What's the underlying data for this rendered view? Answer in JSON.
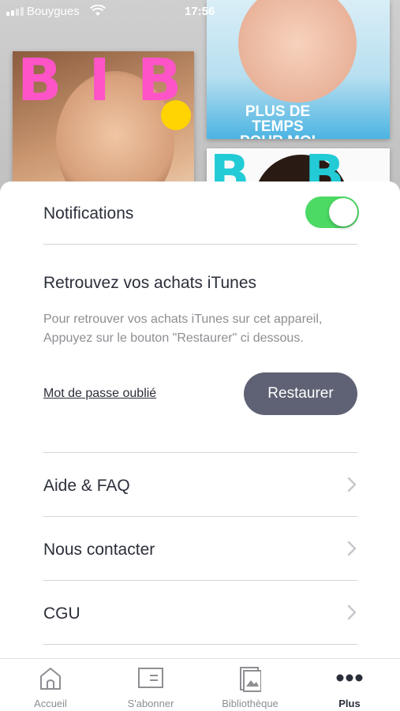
{
  "status_bar": {
    "carrier": "Bouygues",
    "time": "17:56"
  },
  "settings": {
    "notifications_label": "Notifications",
    "notifications_on": true,
    "itunes_title": "Retrouvez vos achats iTunes",
    "itunes_description": "Pour retrouver vos achats iTunes sur cet appareil, Appuyez sur le bouton \"Restaurer\" ci dessous.",
    "forgot_password": "Mot de passe oublié",
    "restore_button": "Restaurer"
  },
  "menu": [
    {
      "label": "Aide & FAQ"
    },
    {
      "label": "Nous contacter"
    },
    {
      "label": "CGU"
    }
  ],
  "tabs": [
    {
      "label": "Accueil",
      "icon": "home-icon"
    },
    {
      "label": "S'abonner",
      "icon": "subscribe-icon"
    },
    {
      "label": "Bibliothèque",
      "icon": "library-icon"
    },
    {
      "label": "Plus",
      "icon": "more-icon",
      "active": true
    }
  ],
  "colors": {
    "toggle_on": "#4cd964",
    "restore_button": "#5e6274",
    "text": "#2b2f3a",
    "muted": "#8e8e93"
  }
}
